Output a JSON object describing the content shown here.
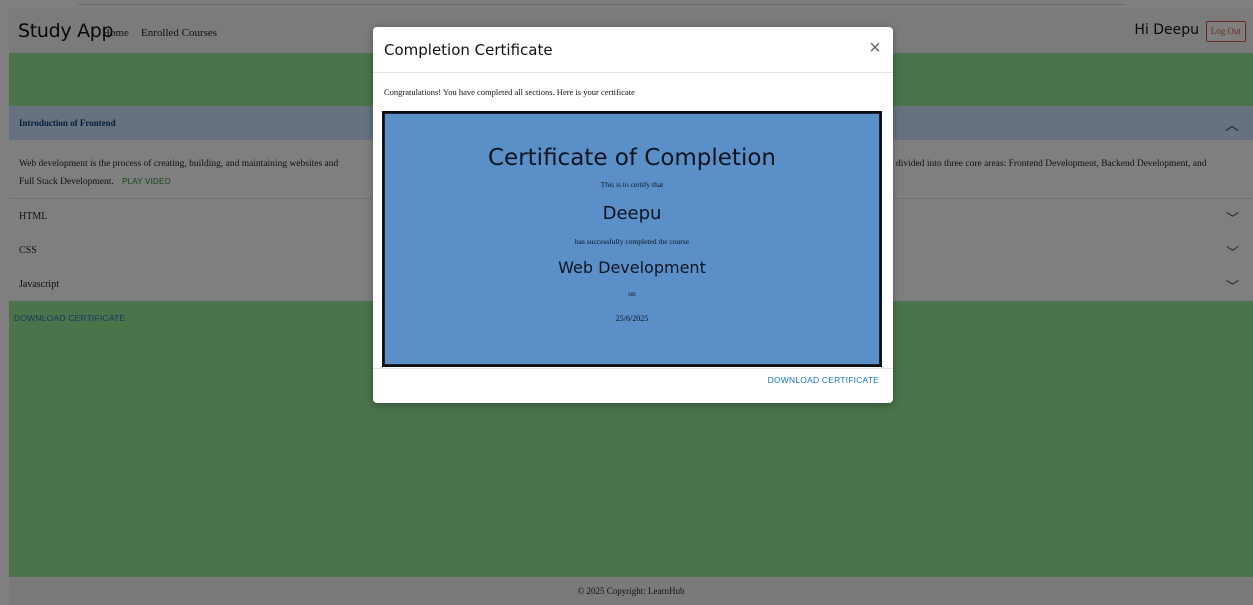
{
  "navbar": {
    "brand": "Study App",
    "links": [
      "Home",
      "Enrolled Courses"
    ],
    "greeting": "Hi Deepu",
    "logout_label": "Log Out"
  },
  "course": {
    "sections": [
      {
        "title": "Introduction of Frontend",
        "expanded": true,
        "content": "Web development is the process of creating, building, and maintaining websites and",
        "content_tail": "enerally divided into three core areas: Frontend Development, Backend Development, and Full Stack Development.",
        "play_label": "PLAY VIDEO"
      },
      {
        "title": "HTML",
        "expanded": false
      },
      {
        "title": "CSS",
        "expanded": false
      },
      {
        "title": "Javascript",
        "expanded": false
      }
    ],
    "download_label": "DOWNLOAD CERTIFICATE"
  },
  "footer": {
    "text": "© 2025 Copyright: LearnHub"
  },
  "modal": {
    "title": "Completion Certificate",
    "message": "Congratulations! You have completed all sections. Here is your certificate",
    "certificate": {
      "heading": "Certificate of Completion",
      "certify_text": "This is to certify that",
      "name": "Deepu",
      "completed_text": "has successfully completed the course",
      "course": "Web Development",
      "on_text": "on",
      "date": "25/6/2025"
    },
    "download_label": "DOWNLOAD CERTIFICATE"
  },
  "icons": {
    "close": "close-icon",
    "expand": "chevron-down-icon",
    "collapse": "chevron-up-icon"
  },
  "colors": {
    "page_green": "#97e897",
    "accordion_active": "#cfe2ff",
    "certificate_bg": "#5b8fc7",
    "link_blue": "#1a73c8",
    "logout_red": "#d9534f"
  }
}
